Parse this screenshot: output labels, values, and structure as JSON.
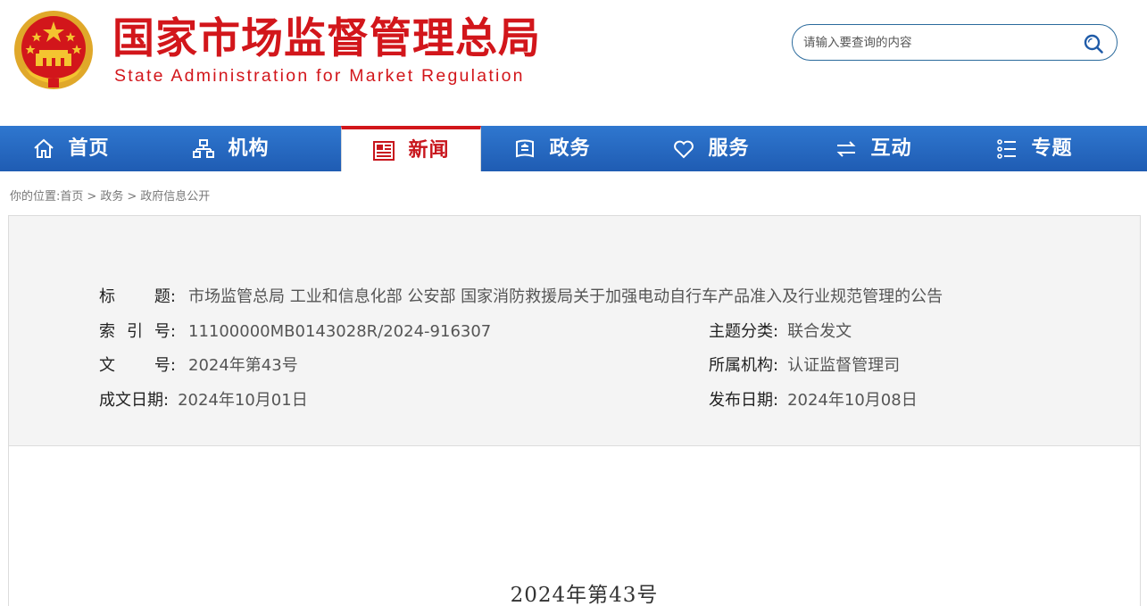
{
  "header": {
    "title_cn": "国家市场监督管理总局",
    "title_en": "State Administration for Market Regulation",
    "emblem_icon": "national-emblem-icon",
    "brand_color": "#d2161b"
  },
  "search": {
    "placeholder": "请输入要查询的内容",
    "icon": "search-icon"
  },
  "nav": {
    "items": [
      {
        "label": "首页",
        "icon": "home-icon"
      },
      {
        "label": "机构",
        "icon": "org-chart-icon"
      },
      {
        "label": "新闻",
        "icon": "newspaper-icon",
        "active": true
      },
      {
        "label": "政务",
        "icon": "document-icon"
      },
      {
        "label": "服务",
        "icon": "heart-icon"
      },
      {
        "label": "互动",
        "icon": "exchange-icon"
      },
      {
        "label": "专题",
        "icon": "list-icon"
      }
    ],
    "bar_color": "#2a6cc4",
    "active_color": "#d2161b"
  },
  "breadcrumb": {
    "prefix": "你的位置:",
    "items": [
      "首页",
      "政务",
      "政府信息公开"
    ],
    "separator": ">"
  },
  "info": {
    "title_label": "标　　题:",
    "title_label_chars": [
      "标",
      "题:"
    ],
    "title_value": "市场监管总局 工业和信息化部 公安部 国家消防救援局关于加强电动自行车产品准入及行业规范管理的公告",
    "index_label_chars": [
      "索",
      "引",
      "号:"
    ],
    "index_value": "11100000MB0143028R/2024-916307",
    "topic_label": "主题分类:",
    "topic_value": "联合发文",
    "docno_label_chars": [
      "文",
      "号:"
    ],
    "docno_value": "2024年第43号",
    "org_label": "所属机构:",
    "org_value": "认证监督管理司",
    "date_label": "成文日期:",
    "date_value": "2024年10月01日",
    "pub_label": "发布日期:",
    "pub_value": "2024年10月08日"
  },
  "content": {
    "doc_number": "2024年第43号"
  }
}
